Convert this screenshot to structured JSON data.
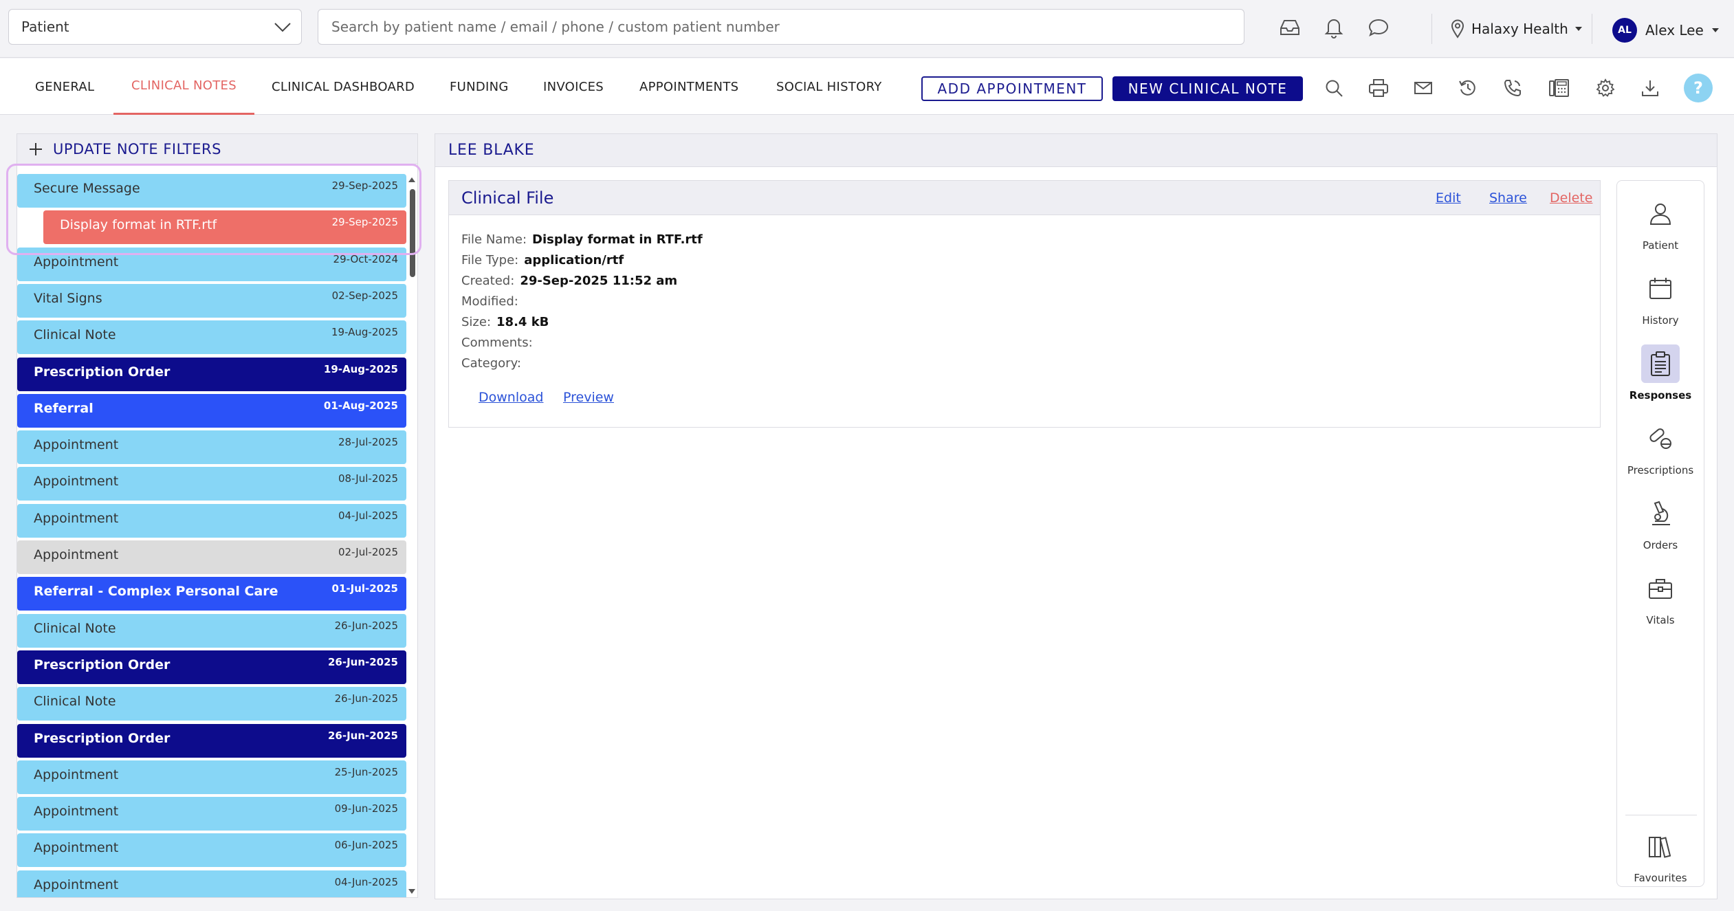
{
  "topbar": {
    "patient_select": "Patient",
    "search_placeholder": "Search by patient name / email / phone / custom patient number",
    "location": "Halaxy Health",
    "user_initials": "AL",
    "user_name": "Alex Lee"
  },
  "nav": {
    "tabs": [
      {
        "label": "GENERAL"
      },
      {
        "label": "CLINICAL NOTES",
        "active": true
      },
      {
        "label": "CLINICAL DASHBOARD"
      },
      {
        "label": "FUNDING"
      },
      {
        "label": "INVOICES"
      },
      {
        "label": "APPOINTMENTS"
      },
      {
        "label": "SOCIAL HISTORY"
      }
    ],
    "add_appointment": "ADD APPOINTMENT",
    "new_clinical_note": "NEW CLINICAL NOTE",
    "help": "?"
  },
  "filters": {
    "label": "UPDATE NOTE FILTERS"
  },
  "notes": [
    {
      "label": "Secure Message",
      "date": "29-Sep-2025",
      "type": "light"
    },
    {
      "label": "Display format in RTF.rtf",
      "date": "29-Sep-2025",
      "type": "red",
      "child": true
    },
    {
      "label": "Appointment",
      "date": "29-Oct-2024",
      "type": "light"
    },
    {
      "label": "Vital Signs",
      "date": "02-Sep-2025",
      "type": "light"
    },
    {
      "label": "Clinical Note",
      "date": "19-Aug-2025",
      "type": "light"
    },
    {
      "label": "Prescription Order",
      "date": "19-Aug-2025",
      "type": "navy"
    },
    {
      "label": "Referral",
      "date": "01-Aug-2025",
      "type": "blue"
    },
    {
      "label": "Appointment",
      "date": "28-Jul-2025",
      "type": "light"
    },
    {
      "label": "Appointment",
      "date": "08-Jul-2025",
      "type": "light"
    },
    {
      "label": "Appointment",
      "date": "04-Jul-2025",
      "type": "light"
    },
    {
      "label": "Appointment",
      "date": "02-Jul-2025",
      "type": "grey"
    },
    {
      "label": "Referral - Complex Personal Care",
      "date": "01-Jul-2025",
      "type": "blue"
    },
    {
      "label": "Clinical Note",
      "date": "26-Jun-2025",
      "type": "light"
    },
    {
      "label": "Prescription Order",
      "date": "26-Jun-2025",
      "type": "navy"
    },
    {
      "label": "Clinical Note",
      "date": "26-Jun-2025",
      "type": "light"
    },
    {
      "label": "Prescription Order",
      "date": "26-Jun-2025",
      "type": "navy"
    },
    {
      "label": "Appointment",
      "date": "25-Jun-2025",
      "type": "light"
    },
    {
      "label": "Appointment",
      "date": "09-Jun-2025",
      "type": "light"
    },
    {
      "label": "Appointment",
      "date": "06-Jun-2025",
      "type": "light"
    },
    {
      "label": "Appointment",
      "date": "04-Jun-2025",
      "type": "light"
    }
  ],
  "detail": {
    "patient_name": "LEE BLAKE",
    "card_title": "Clinical File",
    "edit": "Edit",
    "share": "Share",
    "delete": "Delete",
    "fields": {
      "file_name_label": "File Name:",
      "file_name": "Display format in RTF.rtf",
      "file_type_label": "File Type:",
      "file_type": "application/rtf",
      "created_label": "Created:",
      "created": "29-Sep-2025 11:52 am",
      "modified_label": "Modified:",
      "size_label": "Size:",
      "size": "18.4 kB",
      "comments_label": "Comments:",
      "category_label": "Category:"
    },
    "download": "Download",
    "preview": "Preview"
  },
  "sidebar": {
    "patient": "Patient",
    "history": "History",
    "responses": "Responses",
    "prescriptions": "Prescriptions",
    "orders": "Orders",
    "vitals": "Vitals",
    "favourites": "Favourites"
  },
  "colors": {
    "navy": "#0d0c8c",
    "light_blue": "#87d6f6",
    "bright_blue": "#2b52f8",
    "red": "#ee6f68",
    "grey": "#dcdcdc",
    "active_tab": "#e36563"
  }
}
